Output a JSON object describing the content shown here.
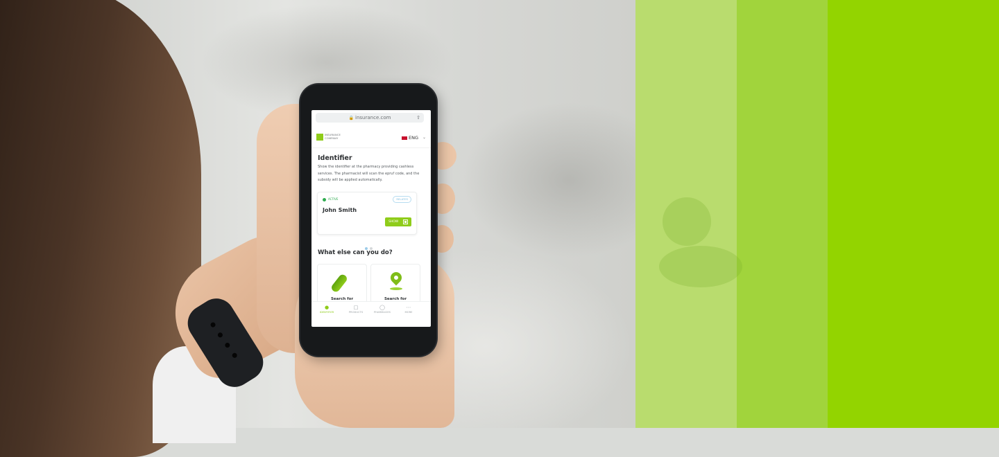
{
  "browser": {
    "url": "insurance.com",
    "lock_icon": "lock-icon",
    "share_icon": "share-icon"
  },
  "header": {
    "logo_text": "INSURANCE\nCOMPANY",
    "language": "ENG",
    "flag_icon": "uk-flag-icon",
    "chevron_icon": "chevron-down-icon"
  },
  "identifier": {
    "title": "Identifier",
    "description": "Show the identifier at the pharmacy providing cashless services. The pharmacist will scan the epruf code, and the subsidy will be applied automatically.",
    "card": {
      "status": "ACTIVE",
      "tag": "RELATES",
      "name": "John Smith",
      "show_label": "SHOW",
      "qr_icon": "qr-code-icon"
    },
    "carousel_pages": 2,
    "carousel_active": 1
  },
  "actions": {
    "title": "What else can you do?",
    "tiles": [
      {
        "label": "Search for",
        "icon": "pill-icon"
      },
      {
        "label": "Search for",
        "icon": "map-pin-icon"
      }
    ]
  },
  "bottom_nav": [
    {
      "label": "IDENTIFIER",
      "icon": "user-icon",
      "active": true
    },
    {
      "label": "PRODUCTS",
      "icon": "box-icon",
      "active": false
    },
    {
      "label": "PHARMACIES",
      "icon": "map-pin-icon",
      "active": false
    },
    {
      "label": "MORE",
      "icon": "more-icon",
      "active": false
    }
  ],
  "colors": {
    "brand_green": "#8fcc1a",
    "stripe_light": "#b9dc6e",
    "stripe_mid": "#a1d43c",
    "stripe_bright": "#93d400",
    "status_active": "#2eab4f"
  }
}
